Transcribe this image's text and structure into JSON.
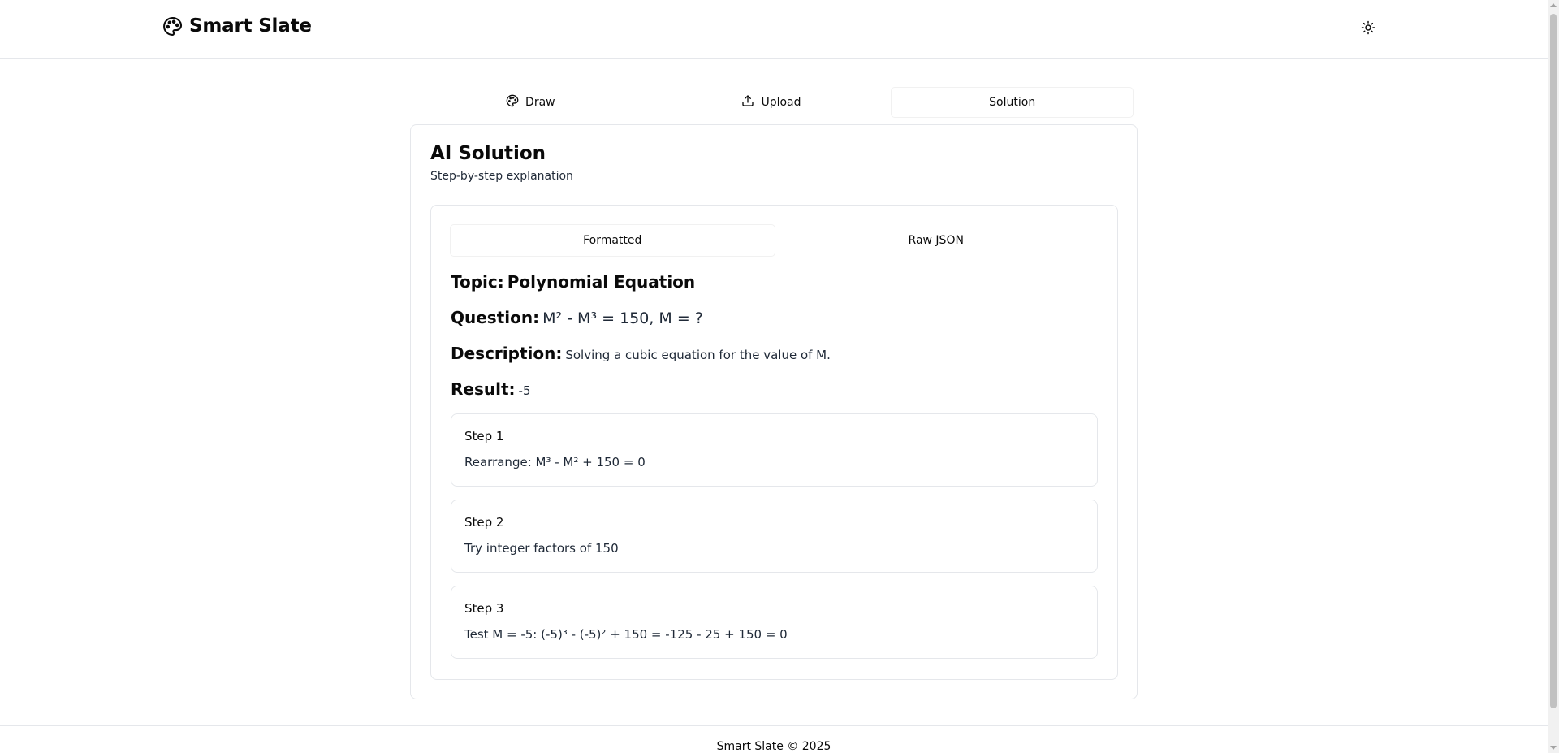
{
  "header": {
    "app_name": "Smart Slate",
    "logo_icon": "palette-icon",
    "theme_icon": "sun-icon"
  },
  "tabs": [
    {
      "label": "Draw",
      "icon": "palette-icon"
    },
    {
      "label": "Upload",
      "icon": "upload-icon"
    },
    {
      "label": "Solution",
      "icon": ""
    }
  ],
  "active_tab": "Solution",
  "card": {
    "title": "AI Solution",
    "subtitle": "Step-by-step explanation"
  },
  "view_tabs": [
    {
      "label": "Formatted"
    },
    {
      "label": "Raw JSON"
    }
  ],
  "active_view_tab": "Formatted",
  "solution": {
    "topic_label": "Topic:",
    "topic_value": "Polynomial Equation",
    "question_label": "Question:",
    "question_value": "M² - M³ = 150, M = ?",
    "description_label": "Description:",
    "description_value": "Solving a cubic equation for the value of M.",
    "result_label": "Result:",
    "result_value": "-5",
    "steps": [
      {
        "title": "Step 1",
        "text": "Rearrange: M³ - M² + 150 = 0"
      },
      {
        "title": "Step 2",
        "text": "Try integer factors of 150"
      },
      {
        "title": "Step 3",
        "text": "Test M = -5: (-5)³ - (-5)² + 150 = -125 - 25 + 150 = 0"
      }
    ]
  },
  "footer": {
    "copyright": "Smart Slate © 2025"
  }
}
